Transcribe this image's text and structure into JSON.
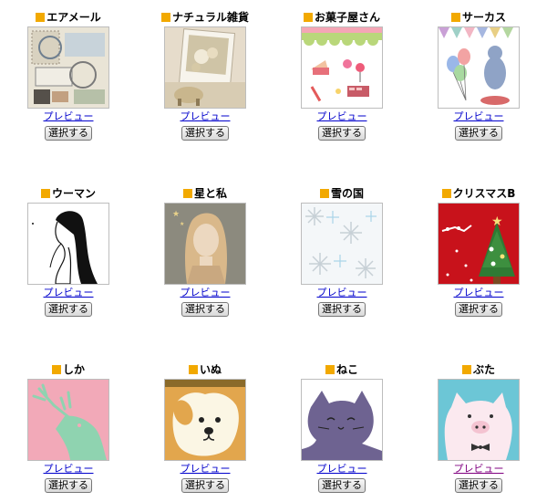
{
  "templates": [
    {
      "title": "エアメール",
      "preview": "プレビュー",
      "select": "選択する",
      "thumb": "stamp-collage-image"
    },
    {
      "title": "ナチュラル雑貨",
      "preview": "プレビュー",
      "select": "選択する",
      "thumb": "flowers-photo-image"
    },
    {
      "title": "お菓子屋さん",
      "preview": "プレビュー",
      "select": "選択する",
      "thumb": "sweets-image"
    },
    {
      "title": "サーカス",
      "preview": "プレビュー",
      "select": "選択する",
      "thumb": "circus-bear-image"
    },
    {
      "title": "ウーマン",
      "preview": "プレビュー",
      "select": "選択する",
      "thumb": "woman-silhouette-image"
    },
    {
      "title": "星と私",
      "preview": "プレビュー",
      "select": "選択する",
      "thumb": "girl-stars-image"
    },
    {
      "title": "雪の国",
      "preview": "プレビュー",
      "select": "選択する",
      "thumb": "snowflakes-image"
    },
    {
      "title": "クリスマスB",
      "preview": "プレビュー",
      "select": "選択する",
      "thumb": "christmas-tree-image"
    },
    {
      "title": "しか",
      "preview": "プレビュー",
      "select": "選択する",
      "thumb": "deer-image"
    },
    {
      "title": "いぬ",
      "preview": "プレビュー",
      "select": "選択する",
      "thumb": "dog-image"
    },
    {
      "title": "ねこ",
      "preview": "プレビュー",
      "select": "選択する",
      "thumb": "cat-image"
    },
    {
      "title": "ぶた",
      "preview": "プレビュー",
      "select": "選択する",
      "thumb": "pig-image"
    }
  ],
  "colors": {
    "accent_square": "#f2a900",
    "link": "#0000cc",
    "visited_link": "#800080"
  }
}
